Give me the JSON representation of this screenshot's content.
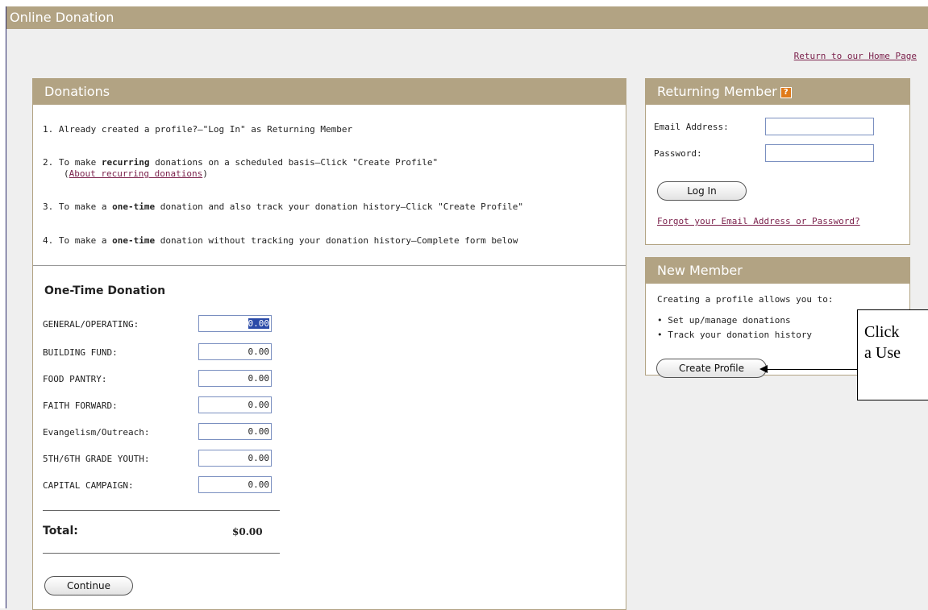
{
  "header": {
    "title": "Online Donation"
  },
  "home_link": "Return to our Home Page",
  "donations": {
    "title": "Donations",
    "steps": [
      {
        "num": "1.",
        "pre": "Already created a profile?—\"Log In\" as Returning Member",
        "bold": "",
        "post": ""
      },
      {
        "num": "2.",
        "pre": "To make ",
        "bold": "recurring",
        "post": " donations on a scheduled basis—Click \"Create Profile\""
      },
      {
        "num": "3.",
        "pre": "To make a ",
        "bold": "one-time",
        "post": " donation and also track your donation history—Click \"Create Profile\""
      },
      {
        "num": "4.",
        "pre": "To make a ",
        "bold": "one-time",
        "post": " donation without tracking your donation history—Complete form below"
      }
    ],
    "recurring_link_open": "(",
    "recurring_link": "About recurring donations",
    "recurring_link_close": ")"
  },
  "one_time": {
    "title": "One-Time Donation",
    "funds": [
      {
        "label": "GENERAL/OPERATING:",
        "value": "0.00"
      },
      {
        "label": "BUILDING FUND:",
        "value": "0.00"
      },
      {
        "label": "FOOD PANTRY:",
        "value": "0.00"
      },
      {
        "label": "FAITH FORWARD:",
        "value": "0.00"
      },
      {
        "label": "Evangelism/Outreach:",
        "value": "0.00"
      },
      {
        "label": "5TH/6TH GRADE YOUTH:",
        "value": "0.00"
      },
      {
        "label": "CAPITAL CAMPAIGN:",
        "value": "0.00"
      }
    ],
    "total_label": "Total:",
    "total_value": "$0.00",
    "continue_label": "Continue"
  },
  "returning": {
    "title": "Returning Member",
    "help_icon": "?",
    "email_label": "Email Address:",
    "password_label": "Password:",
    "email_value": "",
    "password_value": "",
    "login_label": "Log In",
    "forgot_label": "Forgot your Email Address or Password?"
  },
  "new_member": {
    "title": "New Member",
    "intro": "Creating a profile allows you to:",
    "bullets": [
      "Set up/manage donations",
      "Track your donation history"
    ],
    "create_label": "Create Profile"
  },
  "callout": {
    "line1": "Click",
    "line2": "a Use"
  },
  "colors": {
    "accent": "#b2a383",
    "link": "#7a1f4a",
    "input_border": "#7a8fc0"
  }
}
